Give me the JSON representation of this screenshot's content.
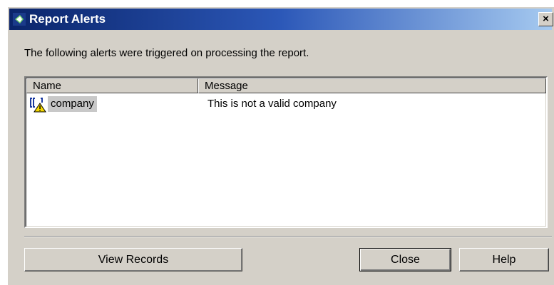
{
  "window": {
    "title": "Report Alerts",
    "close_glyph": "×"
  },
  "prompt": "The following alerts were triggered on processing the report.",
  "list": {
    "columns": [
      "Name",
      "Message"
    ],
    "rows": [
      {
        "name": "company",
        "message": "This is not a valid company",
        "icon": "warning-icon"
      }
    ]
  },
  "buttons": {
    "view_records": "View Records",
    "close": "Close",
    "help": "Help"
  },
  "colors": {
    "titlebar_start": "#0a246a",
    "titlebar_end": "#a6caf0",
    "face": "#d4d0c8",
    "selection": "#c8c8c8"
  }
}
